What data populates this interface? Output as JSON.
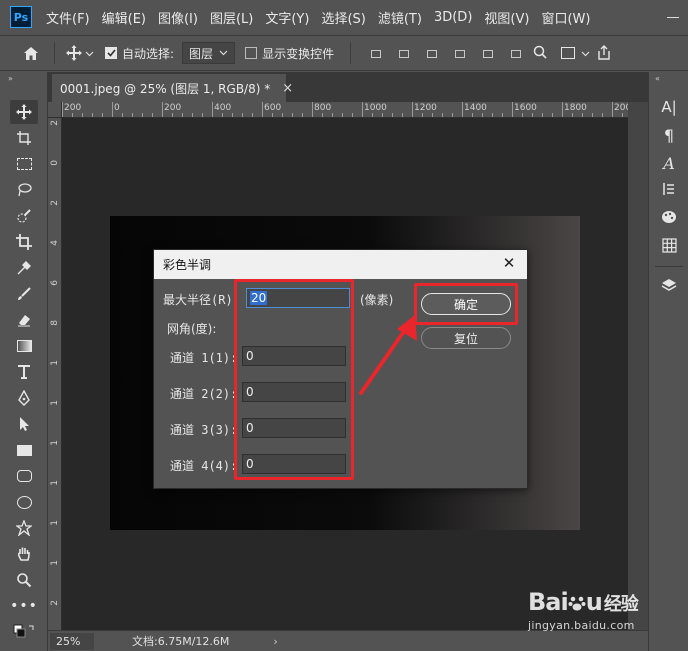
{
  "app": {
    "logo": "Ps"
  },
  "menu": [
    "文件(F)",
    "编辑(E)",
    "图像(I)",
    "图层(L)",
    "文字(Y)",
    "选择(S)",
    "滤镜(T)",
    "3D(D)",
    "视图(V)",
    "窗口(W)"
  ],
  "options_bar": {
    "auto_select_label": "自动选择:",
    "auto_select_checked": true,
    "auto_select_target": "图层",
    "show_transform_label": "显示变换控件",
    "show_transform_checked": false
  },
  "document": {
    "tab_title": "0001.jpeg @ 25% (图层 1, RGB/8) *",
    "close_glyph": "×"
  },
  "ruler": {
    "top_labels": [
      "200",
      "0",
      "200",
      "400",
      "600",
      "800",
      "1000",
      "1200",
      "1400",
      "1600",
      "1800",
      "2000"
    ],
    "left_labels": [
      "2",
      "0",
      "2",
      "4",
      "6",
      "8",
      "1",
      "1",
      "1",
      "1",
      "1",
      "1",
      "2"
    ]
  },
  "status": {
    "zoom": "25%",
    "doc_info": "文档:6.75M/12.6M",
    "arrow": "›"
  },
  "dialog": {
    "title": "彩色半调",
    "max_radius_label": "最大半径(R):",
    "max_radius_value": "20",
    "unit_label": "(像素)",
    "screen_angles_label": "网角(度):",
    "channels": [
      {
        "label": "通道 1(1):",
        "value": "0"
      },
      {
        "label": "通道 2(2):",
        "value": "0"
      },
      {
        "label": "通道 3(3):",
        "value": "0"
      },
      {
        "label": "通道 4(4):",
        "value": "0"
      }
    ],
    "ok_label": "确定",
    "reset_label": "复位"
  },
  "annotation": {
    "highlight_color": "#e8262b"
  },
  "watermark": {
    "brand_a": "Bai",
    "brand_b": "u",
    "brand_cn": "经验",
    "url": "jingyan.baidu.com"
  }
}
